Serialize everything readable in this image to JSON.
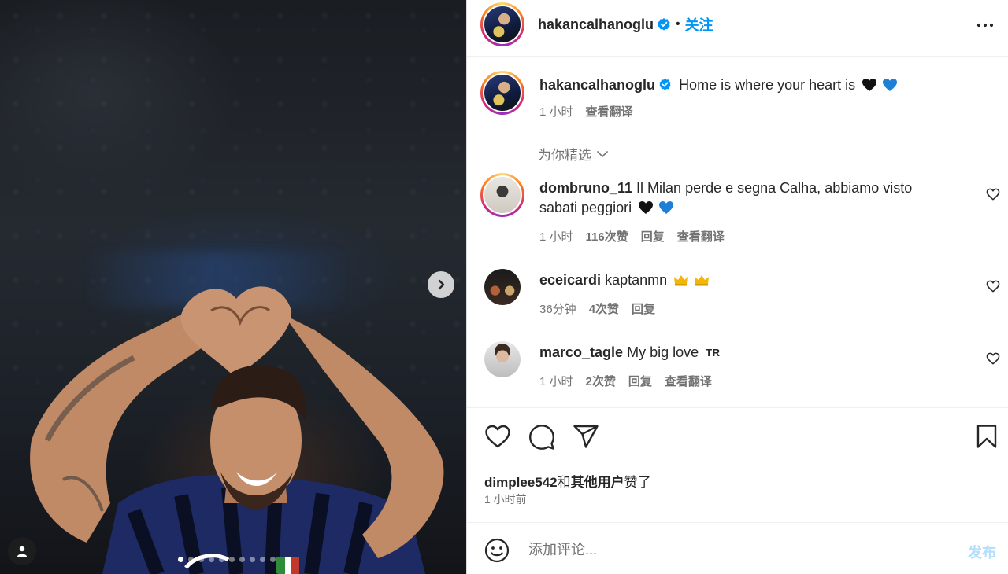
{
  "post": {
    "author": "hakancalhanoglu",
    "follow_label": "关注",
    "separator": "•",
    "caption": "Home is where your heart is",
    "caption_time": "1 小时",
    "caption_translate": "查看翻译",
    "media": {
      "carousel_dots": 10,
      "active_dot": 0
    }
  },
  "for_you_label": "为你精选",
  "comments": [
    {
      "username": "dombruno_11",
      "text": "Il Milan perde e segna Calha, abbiamo visto sabati peggiori",
      "emoji": [
        "black-heart",
        "blue-heart"
      ],
      "time": "1 小时",
      "likes": "116次赞",
      "reply": "回复",
      "translate": "查看翻译"
    },
    {
      "username": "eceicardi",
      "text": "kaptanmn",
      "emoji": [
        "crown",
        "crown"
      ],
      "time": "36分钟",
      "likes": "4次赞",
      "reply": "回复"
    },
    {
      "username": "marco_tagle",
      "text": "My big love",
      "flag": "TR",
      "time": "1 小时",
      "likes": "2次赞",
      "reply": "回复",
      "translate": "查看翻译"
    }
  ],
  "likes_summary": {
    "user": "dimplee542",
    "connector": "和",
    "others": "其他用户",
    "suffix": "赞了"
  },
  "post_time": "1 小时前",
  "comment_box": {
    "placeholder": "添加评论...",
    "post_label": "发布"
  },
  "colors": {
    "accent": "#0095f6",
    "muted": "#737373",
    "post_disabled": "#b2dffc"
  }
}
